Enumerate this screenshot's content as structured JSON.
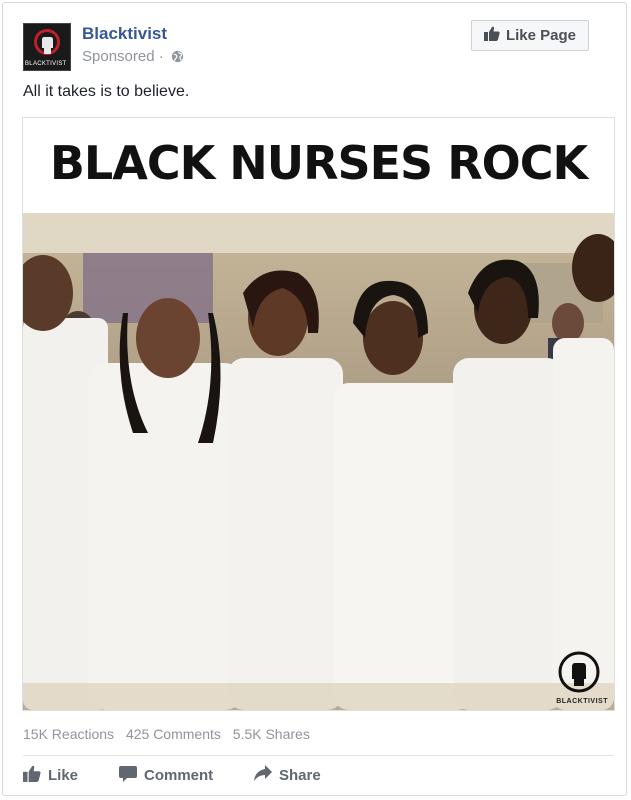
{
  "post": {
    "page_name": "Blacktivist",
    "sponsored_label": "Sponsored",
    "sponsored_separator": " ·",
    "like_page_label": "Like Page",
    "text": "All it takes is to believe.",
    "avatar_text": "BLACKTIVIST"
  },
  "image": {
    "headline": "BLACK NURSES ROCK",
    "watermark_text": "BLACKTIVIST"
  },
  "stats": {
    "reactions": "15K Reactions",
    "comments": "425 Comments",
    "shares": "5.5K Shares"
  },
  "actions": {
    "like": "Like",
    "comment": "Comment",
    "share": "Share"
  },
  "icons": {
    "like": "thumbs-up-icon",
    "comment": "speech-bubble-icon",
    "share": "share-arrow-icon",
    "audience": "globe-icon",
    "avatar": "raised-fist-logo"
  },
  "colors": {
    "link_blue": "#365899",
    "meta_gray": "#90949c",
    "action_gray": "#606770"
  }
}
